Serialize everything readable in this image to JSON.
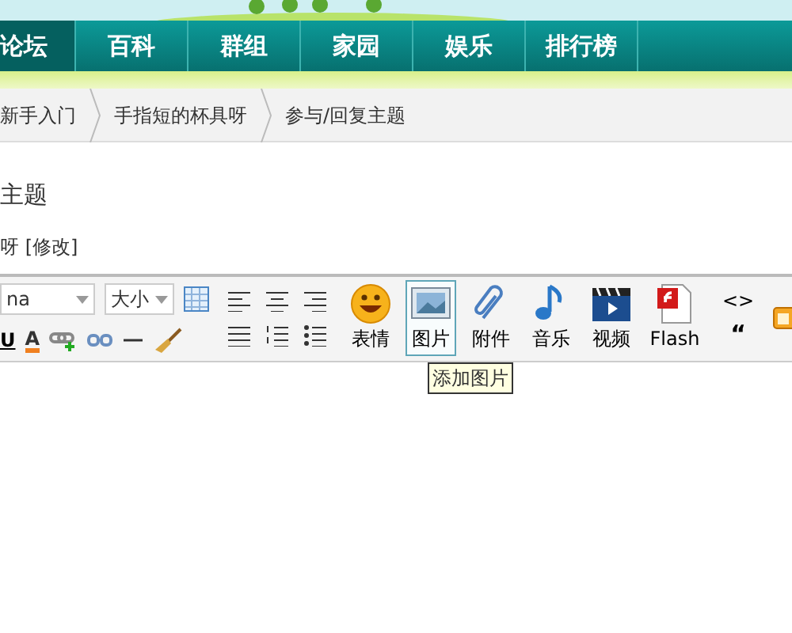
{
  "nav": {
    "items": [
      {
        "label": "论坛",
        "selected": true
      },
      {
        "label": "百科",
        "selected": false
      },
      {
        "label": "群组",
        "selected": false
      },
      {
        "label": "家园",
        "selected": false
      },
      {
        "label": "娱乐",
        "selected": false
      },
      {
        "label": "排行榜",
        "selected": false
      }
    ]
  },
  "breadcrumb": [
    "新手入门",
    "手指短的杯具呀",
    "参与/回复主题"
  ],
  "heading": "主题",
  "subject": "呀",
  "edit_link": "[修改]",
  "editor": {
    "font_select": "na",
    "size_select": "大小",
    "underline_label": "U",
    "color_label": "A",
    "code_label": "<>",
    "quote_label": "“",
    "media_buttons": [
      {
        "kind": "emoji",
        "label": "表情",
        "selected": false
      },
      {
        "kind": "image",
        "label": "图片",
        "selected": true
      },
      {
        "kind": "attach",
        "label": "附件",
        "selected": false
      },
      {
        "kind": "music",
        "label": "音乐",
        "selected": false
      },
      {
        "kind": "video",
        "label": "视频",
        "selected": false
      },
      {
        "kind": "flash",
        "label": "Flash",
        "selected": false
      }
    ],
    "tooltip": "添加图片"
  }
}
